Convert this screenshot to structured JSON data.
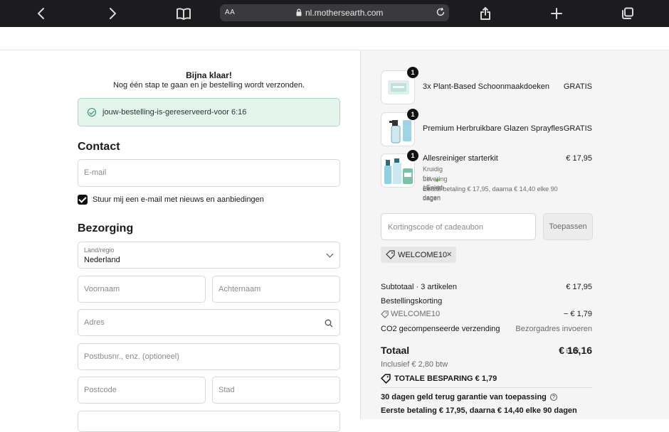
{
  "browser": {
    "text_size_label": "AA",
    "url": "nl.mothersearth.com",
    "icons": [
      "back-icon",
      "forward-icon",
      "bookmarks-icon",
      "lock-icon",
      "reload-icon",
      "share-icon",
      "new-tab-icon",
      "tabs-icon"
    ]
  },
  "checkout": {
    "almost_title": "Bijna klaar!",
    "almost_subtitle": "Nog één stap te gaan en je bestelling wordt verzonden.",
    "reservation_text": "jouw-bestelling-is-gereserveerd-voor 6:16",
    "contact_heading": "Contact",
    "email_placeholder": "E-mail",
    "newsletter_label": "Stuur mij een e-mail met nieuws en aanbiedingen",
    "newsletter_checked": true,
    "delivery_heading": "Bezorging",
    "country_label": "Land/regio",
    "country_value": "Nederland",
    "firstname_placeholder": "Voornaam",
    "lastname_placeholder": "Achternaam",
    "address_placeholder": "Adres",
    "addition_placeholder": "Postbusnr., enz. (optioneel)",
    "postcode_placeholder": "Postcode",
    "city_placeholder": "Stad"
  },
  "summary": {
    "items": [
      {
        "qty": "1",
        "name": "3x Plant-Based Schoonmaakdoeken",
        "price": "GRATIS"
      },
      {
        "qty": "1",
        "name": "Premium Herbruikbare Glazen Sprayfles",
        "price": "GRATIS"
      },
      {
        "qty": "1",
        "name": "Allesreiniger starterkit",
        "price": "€ 17,95",
        "variant": "Kruidig fris 🍃 / Enkel",
        "delivery": "Levering elke 90 dagen",
        "first_payment": "Eerste betaling € 17,95, daarna € 14,40 elke 90 dagen"
      }
    ],
    "discount_placeholder": "Kortingscode of cadeaubon",
    "apply_label": "Toepassen",
    "applied_code": "WELCOME10",
    "subtotal_label": "Subtotaal · 3 artikelen",
    "subtotal_value": "€ 17,95",
    "order_discount_label": "Bestellingskorting",
    "discount_code_line": "WELCOME10",
    "discount_value": "− € 1,79",
    "shipping_label": "CO2 gecompenseerde verzending",
    "shipping_value": "Bezorgadres invoeren",
    "total_label": "Totaal",
    "total_currency": "EUR",
    "total_value": "€ 16,16",
    "tax_line": "Inclusief € 2,80 btw",
    "savings_line": "TOTALE BESPARING  € 1,79",
    "guarantee_line": "30 dagen geld terug garantie van toepassing",
    "first_payment_line": "Eerste betaling € 17,95, daarna € 14,40 elke 90 dagen"
  },
  "colors": {
    "browser_bar": "#1c1c1e",
    "reservation_bg": "#e3f5ec",
    "summary_bg": "#f5f5f5"
  }
}
